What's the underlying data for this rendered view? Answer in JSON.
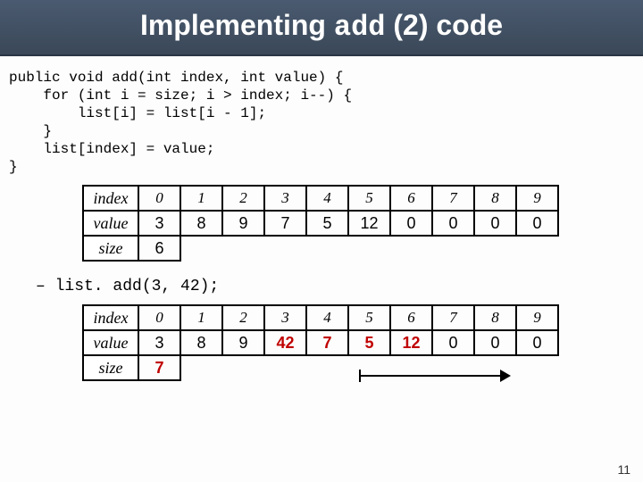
{
  "title_pre": "Implementing ",
  "title_mono": "add",
  "title_post": " (2) code",
  "code": "public void add(int index, int value) {\n    for (int i = size; i > index; i--) {\n        list[i] = list[i - 1];\n    }\n    list[index] = value;\n}",
  "table1": {
    "index_label": "index",
    "value_label": "value",
    "size_label": "size",
    "indices": [
      "0",
      "1",
      "2",
      "3",
      "4",
      "5",
      "6",
      "7",
      "8",
      "9"
    ],
    "values": [
      "3",
      "8",
      "9",
      "7",
      "5",
      "12",
      "0",
      "0",
      "0",
      "0"
    ],
    "size": "6"
  },
  "call": "– list. add(3, 42);",
  "table2": {
    "index_label": "index",
    "value_label": "value",
    "size_label": "size",
    "indices": [
      "0",
      "1",
      "2",
      "3",
      "4",
      "5",
      "6",
      "7",
      "8",
      "9"
    ],
    "values": [
      "3",
      "8",
      "9",
      "42",
      "7",
      "5",
      "12",
      "0",
      "0",
      "0"
    ],
    "bold_red_cols": [
      3,
      4,
      5,
      6
    ],
    "size": "7"
  },
  "page": "11"
}
